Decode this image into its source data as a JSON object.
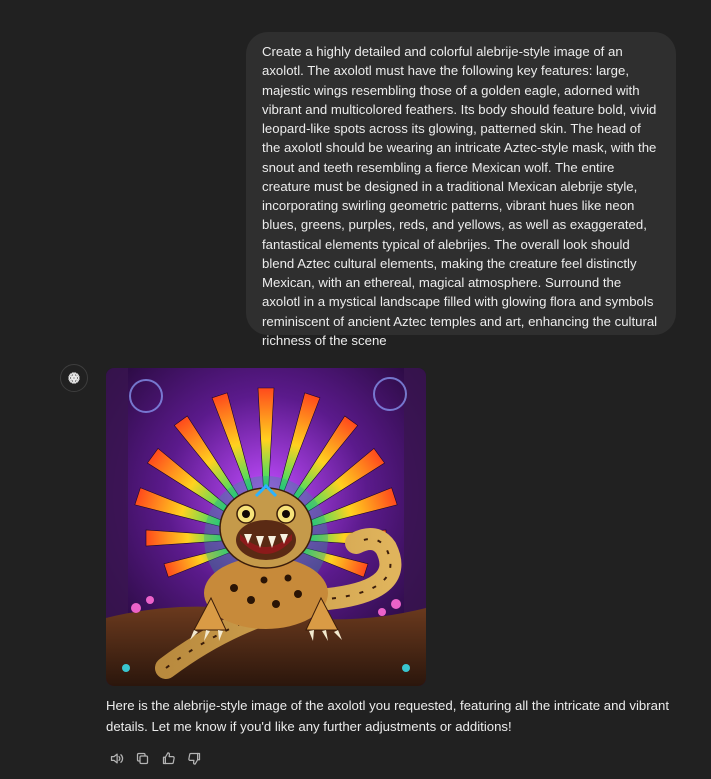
{
  "conversation": {
    "user_message": "Create a highly detailed and colorful alebrije-style image of an axolotl. The axolotl must have the following key features: large, majestic wings resembling those of a golden eagle, adorned with vibrant and multicolored feathers. Its body should feature bold, vivid leopard-like spots across its glowing, patterned skin. The head of the axolotl should be wearing an intricate Aztec-style mask, with the snout and teeth resembling a fierce Mexican wolf. The entire creature must be designed in a traditional Mexican alebrije style, incorporating swirling geometric patterns, vibrant hues like neon blues, greens, purples, reds, and yellows, as well as exaggerated, fantastical elements typical of alebrijes. The overall look should blend Aztec cultural elements, making the creature feel distinctly Mexican, with an ethereal, magical atmosphere. Surround the axolotl in a mystical landscape filled with glowing flora and symbols reminiscent of ancient Aztec temples and art, enhancing the cultural richness of the scene",
    "assistant_message": "Here is the alebrije-style image of the axolotl you requested, featuring all the intricate and vibrant details. Let me know if you'd like any further adjustments or additions!"
  },
  "icons": {
    "avatar": "openai-logo-icon",
    "actions": [
      "speaker-icon",
      "copy-icon",
      "thumbs-up-icon",
      "thumbs-down-icon"
    ]
  },
  "colors": {
    "background": "#212121",
    "user_bubble": "#2f2f2f",
    "text": "#ececec",
    "icon": "#b4b4b4"
  }
}
